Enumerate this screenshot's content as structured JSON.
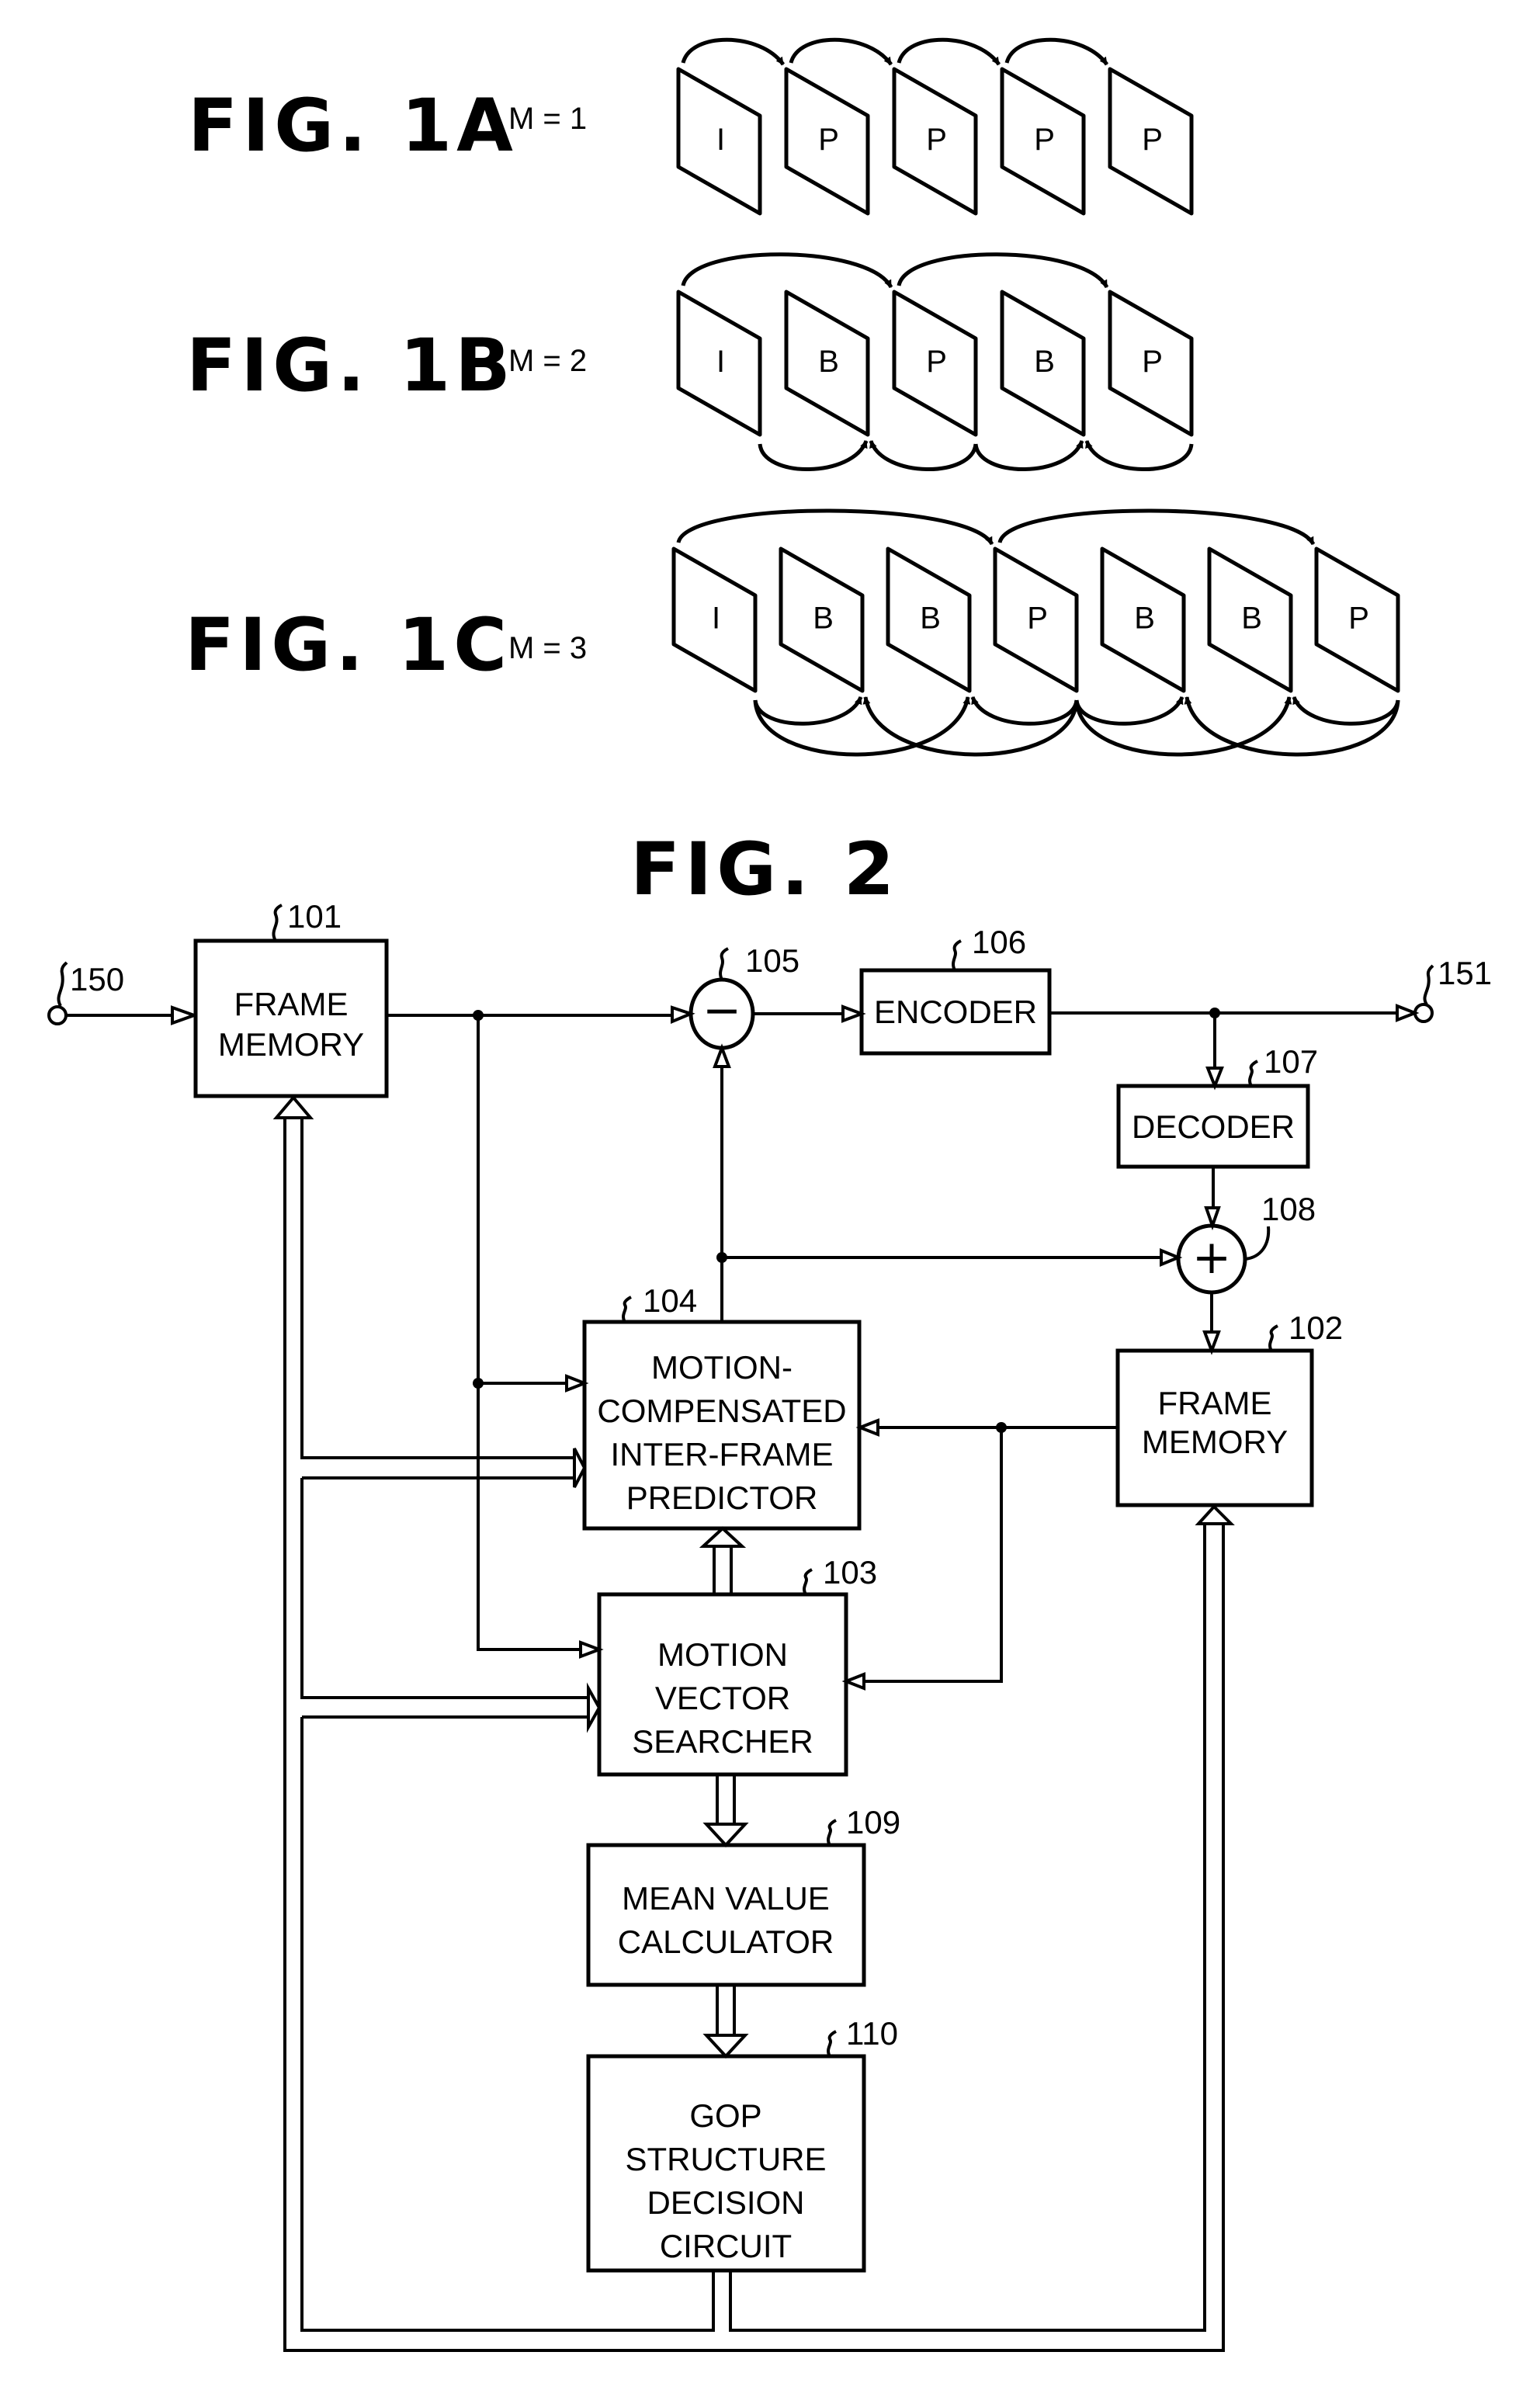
{
  "fig1": {
    "panels": [
      {
        "title": "FIG. 1A",
        "m_label": "M = 1",
        "frames": [
          "I",
          "P",
          "P",
          "P",
          "P"
        ]
      },
      {
        "title": "FIG. 1B",
        "m_label": "M = 2",
        "frames": [
          "I",
          "B",
          "P",
          "B",
          "P"
        ]
      },
      {
        "title": "FIG. 1C",
        "m_label": "M = 3",
        "frames": [
          "I",
          "B",
          "B",
          "P",
          "B",
          "B",
          "P"
        ]
      }
    ]
  },
  "fig2": {
    "title": "FIG. 2",
    "input_ref": "150",
    "output_ref": "151",
    "blocks": {
      "frame_memory_in": {
        "ref": "101",
        "lines": [
          "FRAME",
          "MEMORY"
        ]
      },
      "frame_memory_out": {
        "ref": "102",
        "lines": [
          "FRAME",
          "MEMORY"
        ]
      },
      "motion_vector_searcher": {
        "ref": "103",
        "lines": [
          "MOTION",
          "VECTOR",
          "SEARCHER"
        ]
      },
      "predictor": {
        "ref": "104",
        "lines": [
          "MOTION-",
          "COMPENSATED",
          "INTER-FRAME",
          "PREDICTOR"
        ]
      },
      "subtractor": {
        "ref": "105",
        "symbol": "−"
      },
      "encoder": {
        "ref": "106",
        "lines": [
          "ENCODER"
        ]
      },
      "decoder": {
        "ref": "107",
        "lines": [
          "DECODER"
        ]
      },
      "adder": {
        "ref": "108",
        "symbol": "+"
      },
      "mean_value_calculator": {
        "ref": "109",
        "lines": [
          "MEAN VALUE",
          "CALCULATOR"
        ]
      },
      "gop_decision": {
        "ref": "110",
        "lines": [
          "GOP",
          "STRUCTURE",
          "DECISION",
          "CIRCUIT"
        ]
      }
    }
  }
}
